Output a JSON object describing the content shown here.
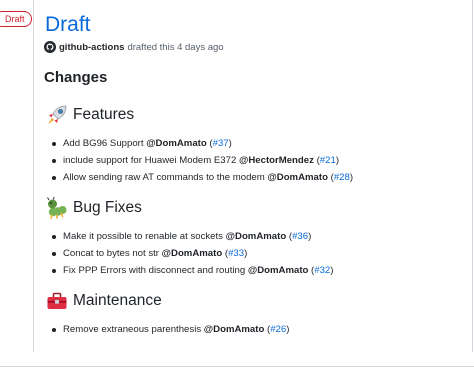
{
  "release": {
    "badge": "Draft",
    "title": "Draft",
    "author": "github-actions",
    "drafted_text": "drafted this 4 days ago"
  },
  "changes_heading": "Changes",
  "sections": [
    {
      "title": "Features",
      "icon": "rocket-icon",
      "items": [
        {
          "text": "Add BG96 Support ",
          "mention": "@DomAmato",
          "open": " (",
          "ref": "#37",
          "close": ")"
        },
        {
          "text": "include support for Huawei Modem E372 ",
          "mention": "@HectorMendez",
          "open": " (",
          "ref": "#21",
          "close": ")"
        },
        {
          "text": "Allow sending raw AT commands to the modem ",
          "mention": "@DomAmato",
          "open": " (",
          "ref": "#28",
          "close": ")"
        }
      ]
    },
    {
      "title": "Bug Fixes",
      "icon": "bug-icon",
      "items": [
        {
          "text": "Make it possible to renable at sockets ",
          "mention": "@DomAmato",
          "open": " (",
          "ref": "#36",
          "close": ")"
        },
        {
          "text": "Concat to bytes not str ",
          "mention": "@DomAmato",
          "open": " (",
          "ref": "#33",
          "close": ")"
        },
        {
          "text": "Fix PPP Errors with disconnect and routing ",
          "mention": "@DomAmato",
          "open": " (",
          "ref": "#32",
          "close": ")"
        }
      ]
    },
    {
      "title": "Maintenance",
      "icon": "toolbox-icon",
      "items": [
        {
          "text": "Remove extraneous parenthesis ",
          "mention": "@DomAmato",
          "open": " (",
          "ref": "#26",
          "close": ")"
        }
      ]
    }
  ]
}
